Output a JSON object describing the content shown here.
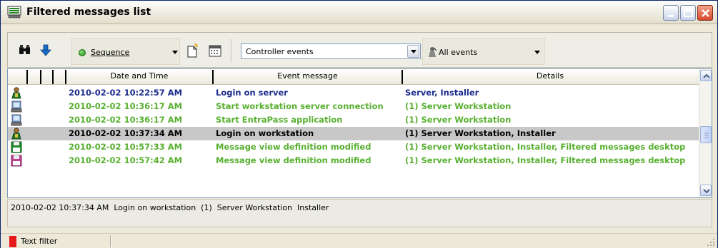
{
  "window": {
    "title": "Filtered messages list"
  },
  "toolbar": {
    "sequence_label": "Sequence",
    "event_type_value": "Controller events",
    "events_filter_label": "All events"
  },
  "grid": {
    "columns": [
      "Date and Time",
      "Event message",
      "Details"
    ],
    "rows": [
      {
        "icon": "user-key-icon",
        "color": "#1c2c8c",
        "date": "2010-02-02 10:22:57 AM",
        "message": "Login on server",
        "details": "Server, Installer",
        "selected": false
      },
      {
        "icon": "workstation-icon",
        "color": "#58b030",
        "date": "2010-02-02 10:36:17 AM",
        "message": "Start workstation server connection",
        "details": "(1) Server Workstation",
        "selected": false
      },
      {
        "icon": "workstation-icon",
        "color": "#58b030",
        "date": "2010-02-02 10:36:17 AM",
        "message": "Start EntraPass application",
        "details": "(1) Server Workstation",
        "selected": false
      },
      {
        "icon": "user-key-icon",
        "color": "#000000",
        "date": "2010-02-02 10:37:34 AM",
        "message": "Login on workstation",
        "details": "(1) Server Workstation, Installer",
        "selected": true
      },
      {
        "icon": "floppy-green-icon",
        "color": "#58b030",
        "date": "2010-02-02 10:57:33 AM",
        "message": "Message view definition modified",
        "details": "(1) Server Workstation, Installer, Filtered messages desktop",
        "selected": false
      },
      {
        "icon": "floppy-pink-icon",
        "color": "#58b030",
        "date": "2010-02-02 10:57:42 AM",
        "message": "Message view definition modified",
        "details": "(1) Server Workstation, Installer, Filtered messages desktop",
        "selected": false
      }
    ]
  },
  "detail_panel": {
    "text": "2010-02-02 10:37:34 AM  Login on workstation  (1)  Server Workstation  Installer"
  },
  "statusbar": {
    "filter_label": "Text filter",
    "filter_color": "#e51a1a"
  }
}
